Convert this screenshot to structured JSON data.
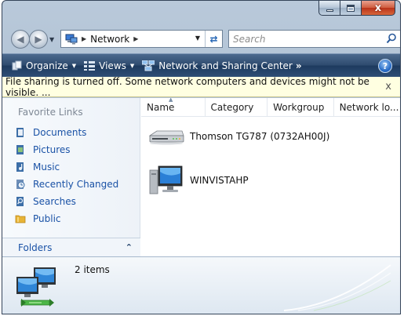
{
  "window": {
    "close_glyph": "x"
  },
  "address_bar": {
    "location": "Network"
  },
  "search": {
    "placeholder": "Search"
  },
  "toolbar": {
    "organize_label": "Organize",
    "views_label": "Views",
    "network_center_label": "Network and Sharing Center",
    "overflow_label": "»",
    "help_label": "?"
  },
  "infobar": {
    "message": "File sharing is turned off. Some network computers and devices might not be visible. ...",
    "close_label": "x"
  },
  "nav_pane": {
    "heading": "Favorite Links",
    "favorites": [
      {
        "label": "Documents",
        "icon": "documents-icon"
      },
      {
        "label": "Pictures",
        "icon": "pictures-icon"
      },
      {
        "label": "Music",
        "icon": "music-icon"
      },
      {
        "label": "Recently Changed",
        "icon": "recently-changed-icon"
      },
      {
        "label": "Searches",
        "icon": "searches-icon"
      },
      {
        "label": "Public",
        "icon": "public-folder-icon"
      }
    ],
    "folders_label": "Folders"
  },
  "columns": [
    "Name",
    "Category",
    "Workgroup",
    "Network lo..."
  ],
  "items": [
    {
      "label": "Thomson TG787 (0732AH00J)",
      "icon": "router-icon"
    },
    {
      "label": "WINVISTAHP",
      "icon": "computer-icon"
    }
  ],
  "details": {
    "count_text": "2 items"
  },
  "colors": {
    "accent_link": "#1a52a6",
    "toolbar": "#2d4a6e",
    "infobar": "#ffffe1",
    "close_button": "#c84a2c"
  }
}
